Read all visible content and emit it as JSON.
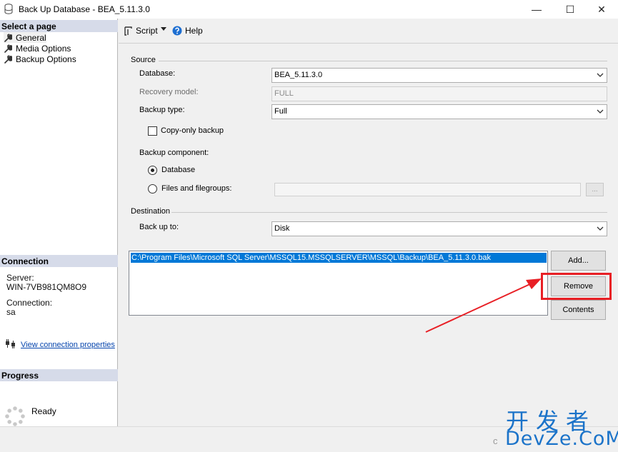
{
  "window": {
    "title": "Back Up Database - BEA_5.11.3.0",
    "minimize_glyph": "—",
    "maximize_glyph": "☐",
    "close_glyph": "✕"
  },
  "left_panel": {
    "select_page_header": "Select a page",
    "pages": [
      {
        "label": "General",
        "icon": "wrench-icon"
      },
      {
        "label": "Media Options",
        "icon": "wrench-icon"
      },
      {
        "label": "Backup Options",
        "icon": "wrench-icon"
      }
    ],
    "connection_header": "Connection",
    "server_label": "Server:",
    "server_value": "WIN-7VB981QM8O9",
    "connection_label": "Connection:",
    "connection_value": "sa",
    "view_connection_link": "View connection properties",
    "progress_header": "Progress",
    "progress_status": "Ready"
  },
  "toolbar": {
    "script_label": "Script",
    "help_label": "Help"
  },
  "source": {
    "group_label": "Source",
    "database_label": "Database:",
    "database_value": "BEA_5.11.3.0",
    "recovery_label": "Recovery model:",
    "recovery_value": "FULL",
    "backup_type_label": "Backup type:",
    "backup_type_value": "Full",
    "copy_only_label": "Copy-only backup",
    "copy_only_checked": false,
    "component_label": "Backup component:",
    "component_database_label": "Database",
    "component_files_label": "Files and filegroups:",
    "browse_label": "..."
  },
  "destination": {
    "group_label": "Destination",
    "back_up_to_label": "Back up to:",
    "back_up_to_value": "Disk",
    "paths": [
      "C:\\Program Files\\Microsoft SQL Server\\MSSQL15.MSSQLSERVER\\MSSQL\\Backup\\BEA_5.11.3.0.bak"
    ],
    "add_label": "Add...",
    "remove_label": "Remove",
    "contents_label": "Contents"
  },
  "watermark": {
    "line1": "开发者",
    "line2": "DevZe.CoM",
    "prefix": "c"
  },
  "colors": {
    "selection": "#0078d7",
    "annotation": "#e81f25",
    "section_header": "#d6dbe9",
    "link": "#0645ad"
  }
}
